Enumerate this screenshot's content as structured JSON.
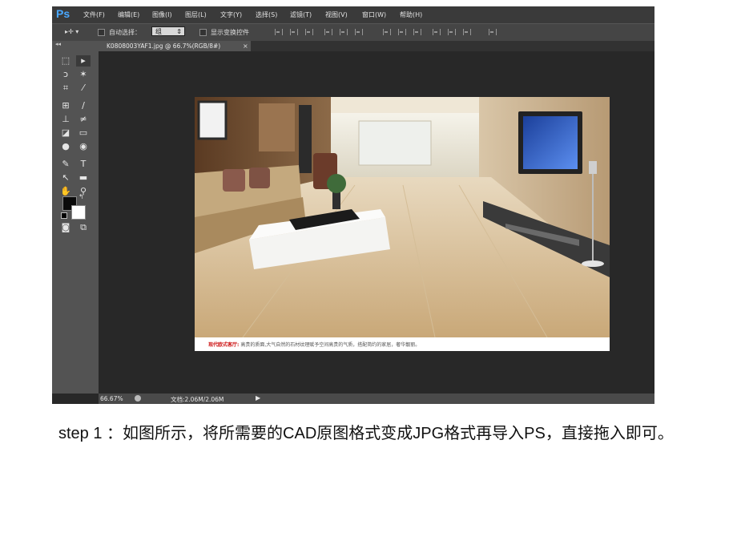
{
  "app": {
    "logo": "Ps",
    "menu": [
      "文件(F)",
      "编辑(E)",
      "图像(I)",
      "图层(L)",
      "文字(Y)",
      "选择(S)",
      "滤镜(T)",
      "视图(V)",
      "窗口(W)",
      "帮助(H)"
    ]
  },
  "options": {
    "auto_select_label": "自动选择：",
    "auto_select_value": "组",
    "show_transform_label": "显示变换控件"
  },
  "tools_panel": {
    "collapse_label": "◂◂",
    "icons": [
      "marquee-tool",
      "move-tool",
      "lasso-tool",
      "magic-wand-tool",
      "crop-tool",
      "eyedropper-tool",
      "spot-healing-tool",
      "brush-tool",
      "clone-stamp-tool",
      "history-brush-tool",
      "eraser-tool",
      "gradient-tool",
      "blur-tool",
      "dodge-tool",
      "pen-tool",
      "type-tool",
      "path-selection-tool",
      "rectangle-tool",
      "hand-tool",
      "zoom-tool",
      "quick-mask-tool",
      "screen-mode-tool"
    ],
    "foreground_color": "#0a0a0a",
    "background_color": "#ffffff"
  },
  "document": {
    "tab_label": "K0808003YAF1.jpg @ 66.7%(RGB/8#)",
    "tab_close": "×",
    "caption_lead": "现代欧式客厅:",
    "caption_text": " 高贵的质面,大气自然的石材纹理赋予空间高贵的气质，搭配简约的家居，奢华靓丽。"
  },
  "status": {
    "zoom": "66.67%",
    "doc_size": "文档:2.06M/2.06M",
    "arrow": "▶"
  },
  "slide": {
    "step_text": "step 1 ：如图所示，将所需要的CAD原图格式变成JPG格式再导入PS，直接拖入即可。"
  }
}
